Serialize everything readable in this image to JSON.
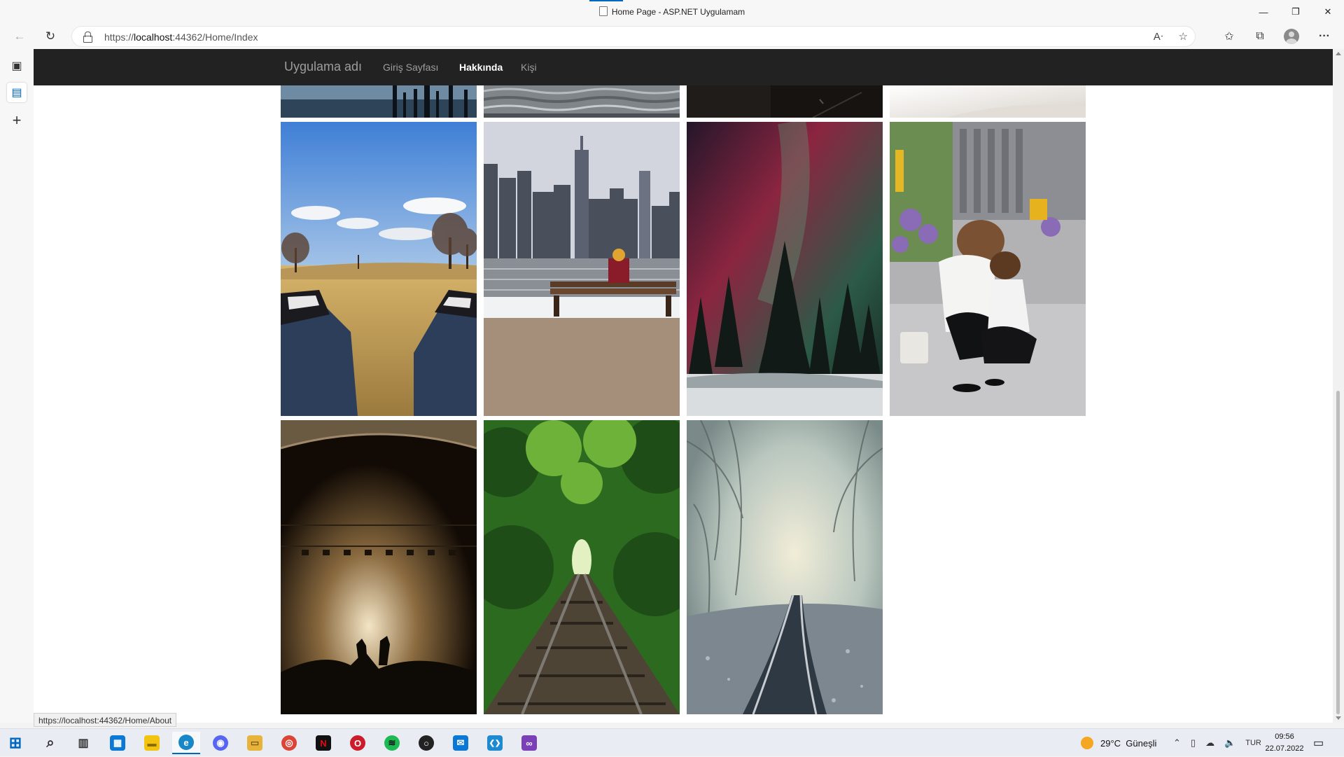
{
  "window": {
    "title": "Home Page - ASP.NET Uygulamam",
    "minimize_glyph": "—",
    "maximize_glyph": "❐",
    "close_glyph": "✕"
  },
  "browser": {
    "url_scheme": "https://",
    "url_host": "localhost",
    "url_rest": ":44362/Home/Index",
    "back_glyph": "←",
    "refresh_glyph": "↻",
    "icons": [
      "read-aloud-icon",
      "add-favorite-icon",
      "favorites-icon",
      "collections-icon",
      "profile-icon",
      "more-icon"
    ],
    "read_aloud_glyph": "Aᐧ",
    "add_fav_glyph": "☆",
    "favorites_glyph": "✩",
    "collections_glyph": "⧉",
    "more_glyph": "···",
    "status_url": "https://localhost:44362/Home/About"
  },
  "sidebar": {
    "tab_actions_glyph": "▣",
    "page_tab_glyph": "▤",
    "new_tab_glyph": "+"
  },
  "site": {
    "brand": "Uygulama adı",
    "nav": [
      {
        "label": "Giriş Sayfası",
        "active": false
      },
      {
        "label": "Hakkında",
        "active": true
      },
      {
        "label": "Kişi",
        "active": false
      }
    ]
  },
  "gallery": {
    "photos": [
      {
        "name": "photo-lake-reflection",
        "colors": [
          "#5e7a9a",
          "#1d2c3c"
        ]
      },
      {
        "name": "photo-water-waves",
        "colors": [
          "#9aa1a6",
          "#4e5559"
        ]
      },
      {
        "name": "photo-dark-interior",
        "colors": [
          "#2a2622",
          "#0f0d0c"
        ]
      },
      {
        "name": "photo-bright-white",
        "colors": [
          "#f4f2ef",
          "#dcd7d0"
        ]
      },
      {
        "name": "photo-sneakers-field",
        "colors": [
          "#5b8fd6",
          "#c9a35a"
        ]
      },
      {
        "name": "photo-city-bench",
        "colors": [
          "#c7cad6",
          "#a48f7b"
        ]
      },
      {
        "name": "photo-aurora-trees",
        "colors": [
          "#7c2742",
          "#1e2b26"
        ]
      },
      {
        "name": "photo-mother-daughter",
        "colors": [
          "#b6b6b8",
          "#4a4a4e"
        ]
      },
      {
        "name": "photo-concert-crowd",
        "colors": [
          "#8a6a3f",
          "#1a1208"
        ]
      },
      {
        "name": "photo-forest-railway",
        "colors": [
          "#2f6d22",
          "#3f3a32"
        ]
      },
      {
        "name": "photo-foggy-railway",
        "colors": [
          "#c9d1c3",
          "#55606a"
        ]
      }
    ]
  },
  "taskbar": {
    "apps": [
      {
        "name": "start-icon",
        "glyph": "⊞",
        "color": "#0067c0"
      },
      {
        "name": "search-icon",
        "glyph": "⌕",
        "color": "#333333"
      },
      {
        "name": "task-view-icon",
        "glyph": "▥",
        "color": "#333333"
      },
      {
        "name": "store-icon",
        "glyph": "▦",
        "color": "#0a78d4"
      },
      {
        "name": "sticky-notes-icon",
        "glyph": "▬",
        "color": "#f3c40f"
      },
      {
        "name": "edge-icon",
        "glyph": "e",
        "color": "#1787c8"
      },
      {
        "name": "discord-icon",
        "glyph": "◉",
        "color": "#5865f2"
      },
      {
        "name": "file-explorer-icon",
        "glyph": "▭",
        "color": "#e8b33a"
      },
      {
        "name": "chrome-icon",
        "glyph": "◎",
        "color": "#db4437"
      },
      {
        "name": "netflix-icon",
        "glyph": "N",
        "color": "#111111"
      },
      {
        "name": "opera-icon",
        "glyph": "O",
        "color": "#cc1b2b"
      },
      {
        "name": "spotify-icon",
        "glyph": "≋",
        "color": "#1db954"
      },
      {
        "name": "app-circle-icon",
        "glyph": "○",
        "color": "#222222"
      },
      {
        "name": "mail-icon",
        "glyph": "✉",
        "color": "#0a78d4"
      },
      {
        "name": "vscode-icon",
        "glyph": "❮❯",
        "color": "#1f8ad2"
      },
      {
        "name": "visual-studio-icon",
        "glyph": "∞",
        "color": "#7b3fb8"
      }
    ],
    "weather": "29°C  Güneşli",
    "lang": "TUR",
    "time": "09:56",
    "date": "22.07.2022"
  }
}
